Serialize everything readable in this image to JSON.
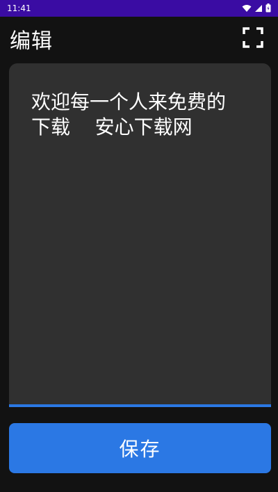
{
  "status_bar": {
    "time": "11:41",
    "icons": [
      "wifi-icon",
      "signal-icon",
      "battery-icon"
    ],
    "background": "#3a0ca3"
  },
  "app_bar": {
    "title": "编辑",
    "action_icon": "fullscreen-icon"
  },
  "editor": {
    "text": "欢迎每一个人来免费的下载    安心下载网",
    "background": "#303030",
    "underline_color": "#2b78e4"
  },
  "save_button": {
    "label": "保存",
    "color": "#2b78e4"
  }
}
